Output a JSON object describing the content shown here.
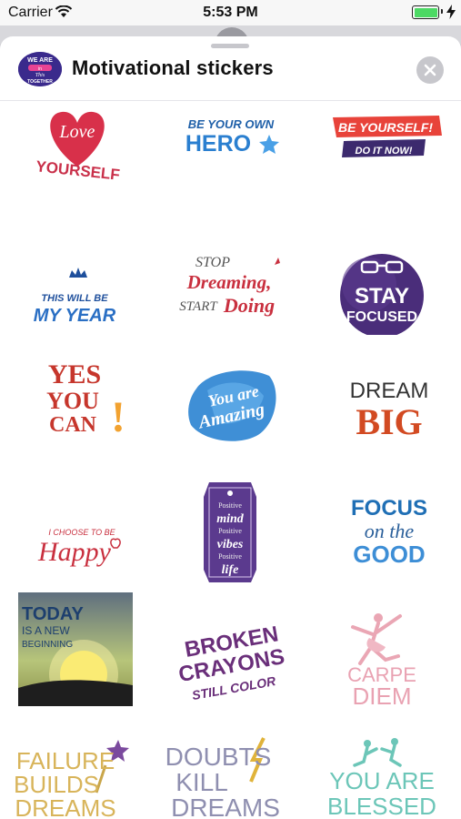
{
  "status_bar": {
    "carrier": "Carrier",
    "time": "5:53 PM"
  },
  "header": {
    "title": "Motivational stickers",
    "app_icon_text": [
      "WE ARE",
      "in",
      "This",
      "TOGETHER"
    ]
  },
  "stickers": [
    {
      "id": "love-yourself",
      "lines": [
        "Love",
        "YOURSELF"
      ]
    },
    {
      "id": "be-your-own-hero",
      "lines": [
        "BE YOUR OWN",
        "HERO"
      ]
    },
    {
      "id": "be-yourself",
      "lines": [
        "BE YOURSELF!",
        "DO IT NOW!"
      ]
    },
    {
      "id": "this-will-be-my-year",
      "lines": [
        "THIS WILL BE",
        "MY YEAR"
      ]
    },
    {
      "id": "stop-dreaming",
      "lines": [
        "STOP",
        "Dreaming,",
        "START",
        "Doing"
      ]
    },
    {
      "id": "stay-focused",
      "lines": [
        "STAY",
        "FOCUSED"
      ]
    },
    {
      "id": "yes-you-can",
      "lines": [
        "YES",
        "YOU",
        "CAN",
        "!"
      ]
    },
    {
      "id": "you-are-amazing",
      "lines": [
        "You are",
        "Amazing"
      ]
    },
    {
      "id": "dream-big",
      "lines": [
        "DREAM",
        "BIG"
      ]
    },
    {
      "id": "choose-happy",
      "lines": [
        "I CHOOSE TO BE",
        "Happy"
      ]
    },
    {
      "id": "positive-mind",
      "lines": [
        "Positive",
        "mind",
        "Positive",
        "vibes",
        "Positive",
        "life"
      ]
    },
    {
      "id": "focus-on-the-good",
      "lines": [
        "FOCUS",
        "on the",
        "GOOD"
      ]
    },
    {
      "id": "today-new-beginning",
      "lines": [
        "TODAY",
        "IS A NEW",
        "BEGINNING"
      ]
    },
    {
      "id": "broken-crayons",
      "lines": [
        "BROKEN",
        "CRAYONS",
        "STILL COLOR"
      ]
    },
    {
      "id": "carpe-diem",
      "lines": [
        "CARPE",
        "DIEM"
      ]
    },
    {
      "id": "failure-builds-dreams",
      "lines": [
        "FAILURE",
        "BUILDS",
        "DREAMS"
      ]
    },
    {
      "id": "doubts-kill-dreams",
      "lines": [
        "DOUBTS",
        "KILL",
        "DREAMS"
      ]
    },
    {
      "id": "you-are-blessed",
      "lines": [
        "YOU ARE",
        "BLESSED"
      ]
    }
  ],
  "colors": {
    "sheet_bg": "#ffffff",
    "close_bg": "#c7c7cc",
    "battery": "#4cd964"
  }
}
